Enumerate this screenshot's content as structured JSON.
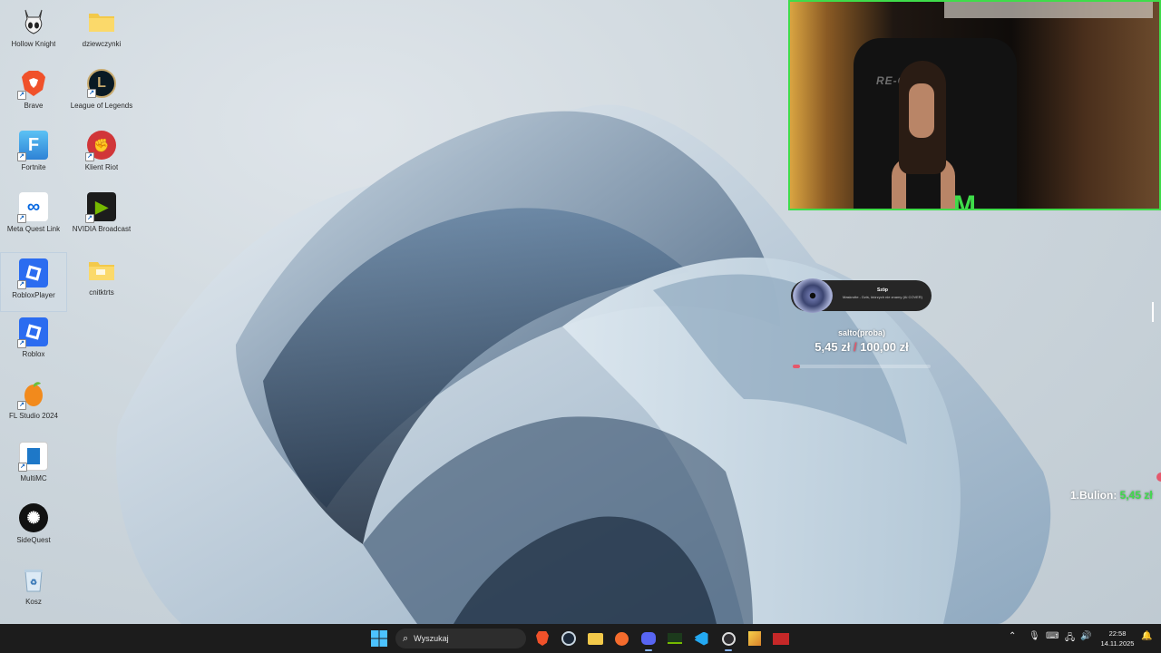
{
  "desktop": {
    "icons": [
      {
        "label": "Hollow Knight",
        "icon": "hollow-knight-icon",
        "color": "#2a2a2a"
      },
      {
        "label": "dziewczynki",
        "icon": "folder-icon",
        "color": "#f3c94a"
      },
      {
        "label": "Brave",
        "icon": "brave-icon",
        "color": "#f0512a"
      },
      {
        "label": "League of Legends",
        "icon": "league-of-legends-icon",
        "color": "#0a1a24"
      },
      {
        "label": "Fortnite",
        "icon": "fortnite-icon",
        "color": "#3fa7ea"
      },
      {
        "label": "Klient Riot",
        "icon": "riot-client-icon",
        "color": "#d13639"
      },
      {
        "label": "Meta Quest Link",
        "icon": "meta-icon",
        "color": "#ffffff"
      },
      {
        "label": "NVIDIA Broadcast",
        "icon": "nvidia-broadcast-icon",
        "color": "#1c1c1c"
      },
      {
        "label": "RobloxPlayer",
        "icon": "roblox-icon",
        "color": "#2b6cf0"
      },
      {
        "label": "cnitktrts",
        "icon": "folder-icon",
        "color": "#f3c94a"
      },
      {
        "label": "Roblox",
        "icon": "roblox-icon",
        "color": "#2b6cf0"
      },
      {
        "label": "FL Studio 2024",
        "icon": "fl-studio-icon",
        "color": "#f28a1c"
      },
      {
        "label": "MultiMC",
        "icon": "multimc-icon",
        "color": "#ffffff"
      },
      {
        "label": "SideQuest",
        "icon": "sidequest-icon",
        "color": "#111111"
      },
      {
        "label": "Kosz",
        "icon": "recycle-bin-icon",
        "color": "#d6e6f2"
      }
    ]
  },
  "overlay": {
    "music": {
      "title": "Szöp",
      "subtitle": "Maskrotte - Dziś, którzych nie znamy (Ai COVER)"
    },
    "goal": {
      "name": "salto(proba)",
      "current": "5,45 zł",
      "separator": "/",
      "target": "100,00 zł",
      "progress": 0.0545
    },
    "donor": {
      "label": "1.Bulion:",
      "amount": "5,45 zł"
    },
    "webcam": {
      "chair_text": "RE-G••RS",
      "accent": "#3fdc4a"
    }
  },
  "taskbar": {
    "search_placeholder": "Wyszukaj",
    "apps": [
      "start-icon",
      "brave-icon",
      "steam-icon",
      "file-explorer-icon",
      "origin-icon",
      "discord-icon",
      "nvidia-icon",
      "vscode-icon",
      "obs-icon",
      "winrar-icon",
      "stream-deck-icon"
    ],
    "time": "22:58",
    "date": "14.11.2025"
  }
}
